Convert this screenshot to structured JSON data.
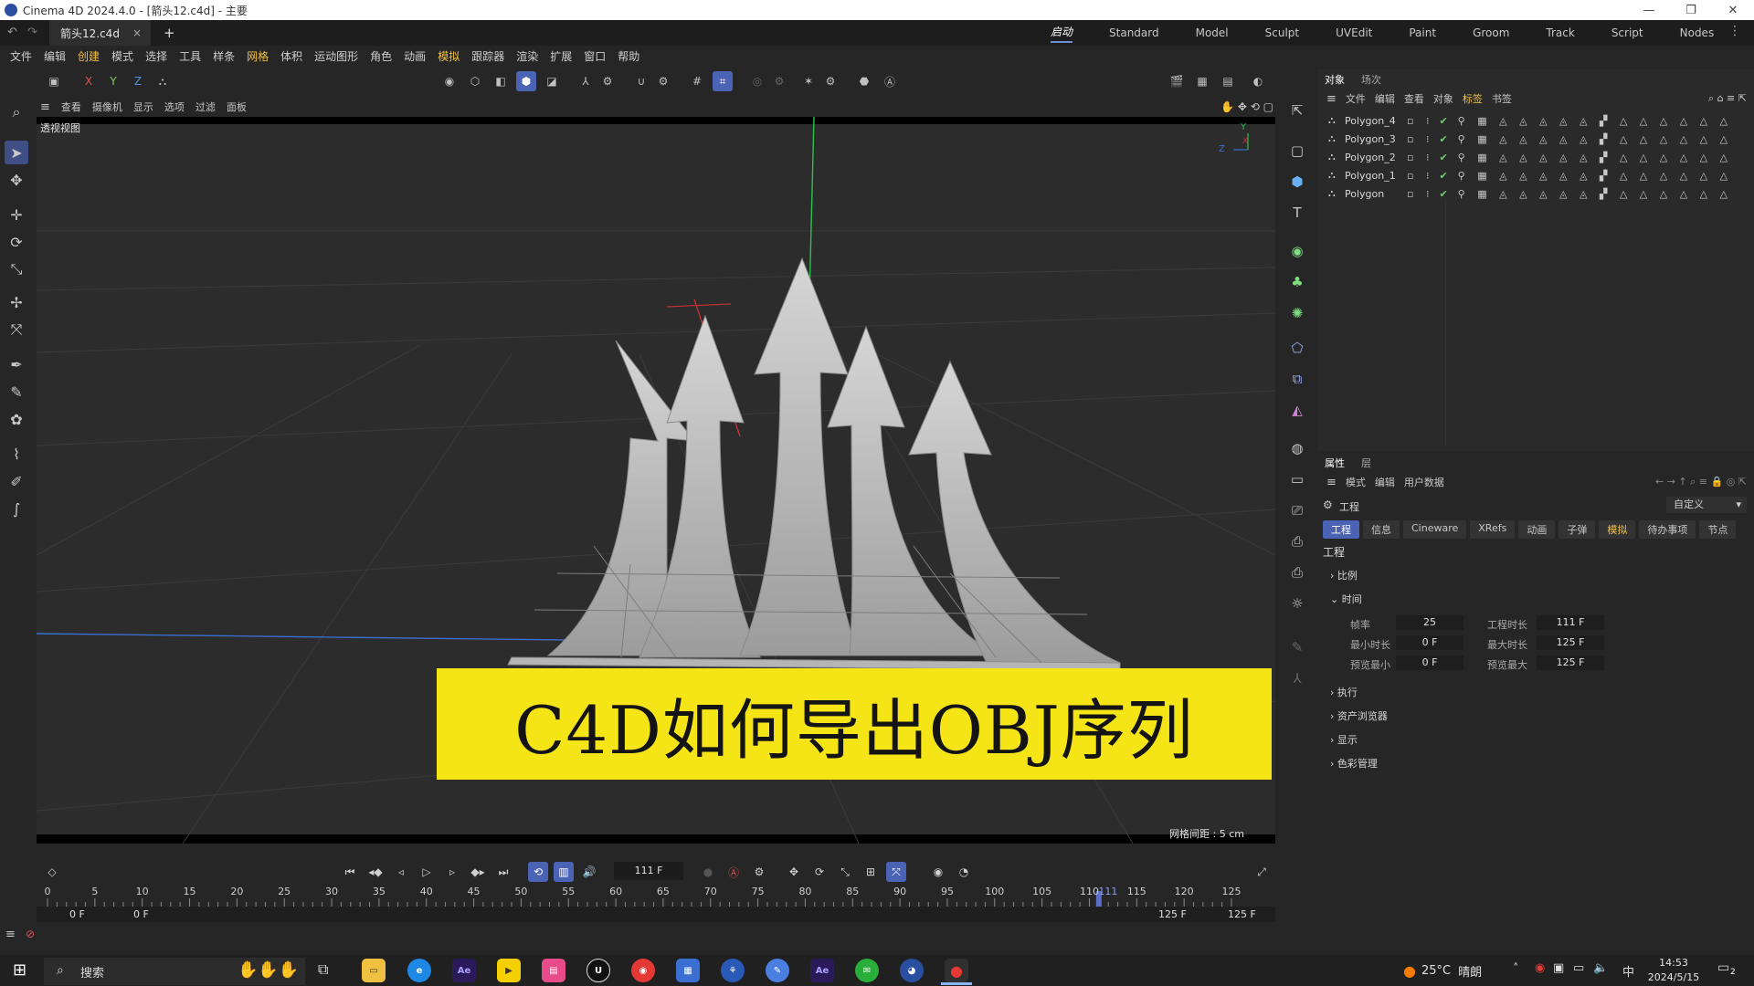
{
  "window": {
    "title": "Cinema 4D 2024.4.0 - [箭头12.c4d] - 主要",
    "controls": [
      "—",
      "❐",
      "✕"
    ]
  },
  "tabs": {
    "document": "箭头12.c4d",
    "close": "×",
    "add": "+",
    "layouts": [
      "启动",
      "Standard",
      "Model",
      "Sculpt",
      "UVEdit",
      "Paint",
      "Groom",
      "Track",
      "Script",
      "Nodes"
    ],
    "active_layout": "启动"
  },
  "menubar": [
    "文件",
    "编辑",
    "创建",
    "模式",
    "选择",
    "工具",
    "样条",
    "网格",
    "体积",
    "运动图形",
    "角色",
    "动画",
    "模拟",
    "跟踪器",
    "渲染",
    "扩展",
    "窗口",
    "帮助"
  ],
  "toolbar": {
    "axes": [
      "X",
      "Y",
      "Z"
    ]
  },
  "viewport": {
    "menu": [
      "查看",
      "摄像机",
      "显示",
      "选项",
      "过滤",
      "面板"
    ],
    "label": "透视视图",
    "grid_spacing": "网格间距 : 5 cm",
    "axis_y": "Y",
    "axis_z": "Z",
    "axis_x": "X",
    "banner": "C4D如何导出OBJ序列",
    "colors": {
      "banner_bg": "#f5e416",
      "y_axis": "#2fbf4f",
      "x_axis": "#c03030",
      "z_axis": "#3a6fd0"
    }
  },
  "objects_panel": {
    "tabs": [
      "对象",
      "场次"
    ],
    "menu": [
      "文件",
      "编辑",
      "查看",
      "对象",
      "标签",
      "书签"
    ],
    "objects": [
      {
        "name": "Polygon_4"
      },
      {
        "name": "Polygon_3"
      },
      {
        "name": "Polygon_2"
      },
      {
        "name": "Polygon_1"
      },
      {
        "name": "Polygon"
      }
    ]
  },
  "attributes_panel": {
    "tabs": [
      "属性",
      "层"
    ],
    "menu": [
      "模式",
      "编辑",
      "用户数据"
    ],
    "header": "工程",
    "preset": "自定义",
    "subtabs": [
      "工程",
      "信息",
      "Cineware",
      "XRefs",
      "动画",
      "子弹",
      "模拟",
      "待办事项",
      "节点"
    ],
    "section_title": "工程",
    "sections": {
      "scale": "比例",
      "time": "时间",
      "exec": "执行",
      "asset": "资产浏览器",
      "display": "显示",
      "color": "色彩管理"
    },
    "fields": {
      "fps_label": "帧率",
      "fps": "25",
      "proj_len_label": "工程时长",
      "proj_len": "111 F",
      "min_label": "最小时长",
      "min": "0 F",
      "max_label": "最大时长",
      "max": "125 F",
      "pmin_label": "预览最小",
      "pmin": "0 F",
      "pmax_label": "预览最大",
      "pmax": "125 F"
    }
  },
  "timeline": {
    "current_frame": "111 F",
    "ticks": [
      "0",
      "5",
      "10",
      "15",
      "20",
      "25",
      "30",
      "35",
      "40",
      "45",
      "50",
      "55",
      "60",
      "65",
      "70",
      "75",
      "80",
      "85",
      "90",
      "95",
      "100",
      "105",
      "110",
      "111",
      "115",
      "120",
      "125"
    ],
    "range_start": "0 F",
    "range_start2": "0 F",
    "range_end": "125 F",
    "range_end2": "125 F"
  },
  "taskbar": {
    "search_placeholder": "搜索",
    "weather_temp": "25°C",
    "weather_desc": "晴朗",
    "time": "14:53",
    "date": "2024/5/15",
    "ime": "中",
    "notif_count": "2",
    "apps": [
      "Ae",
      "Ae"
    ]
  }
}
